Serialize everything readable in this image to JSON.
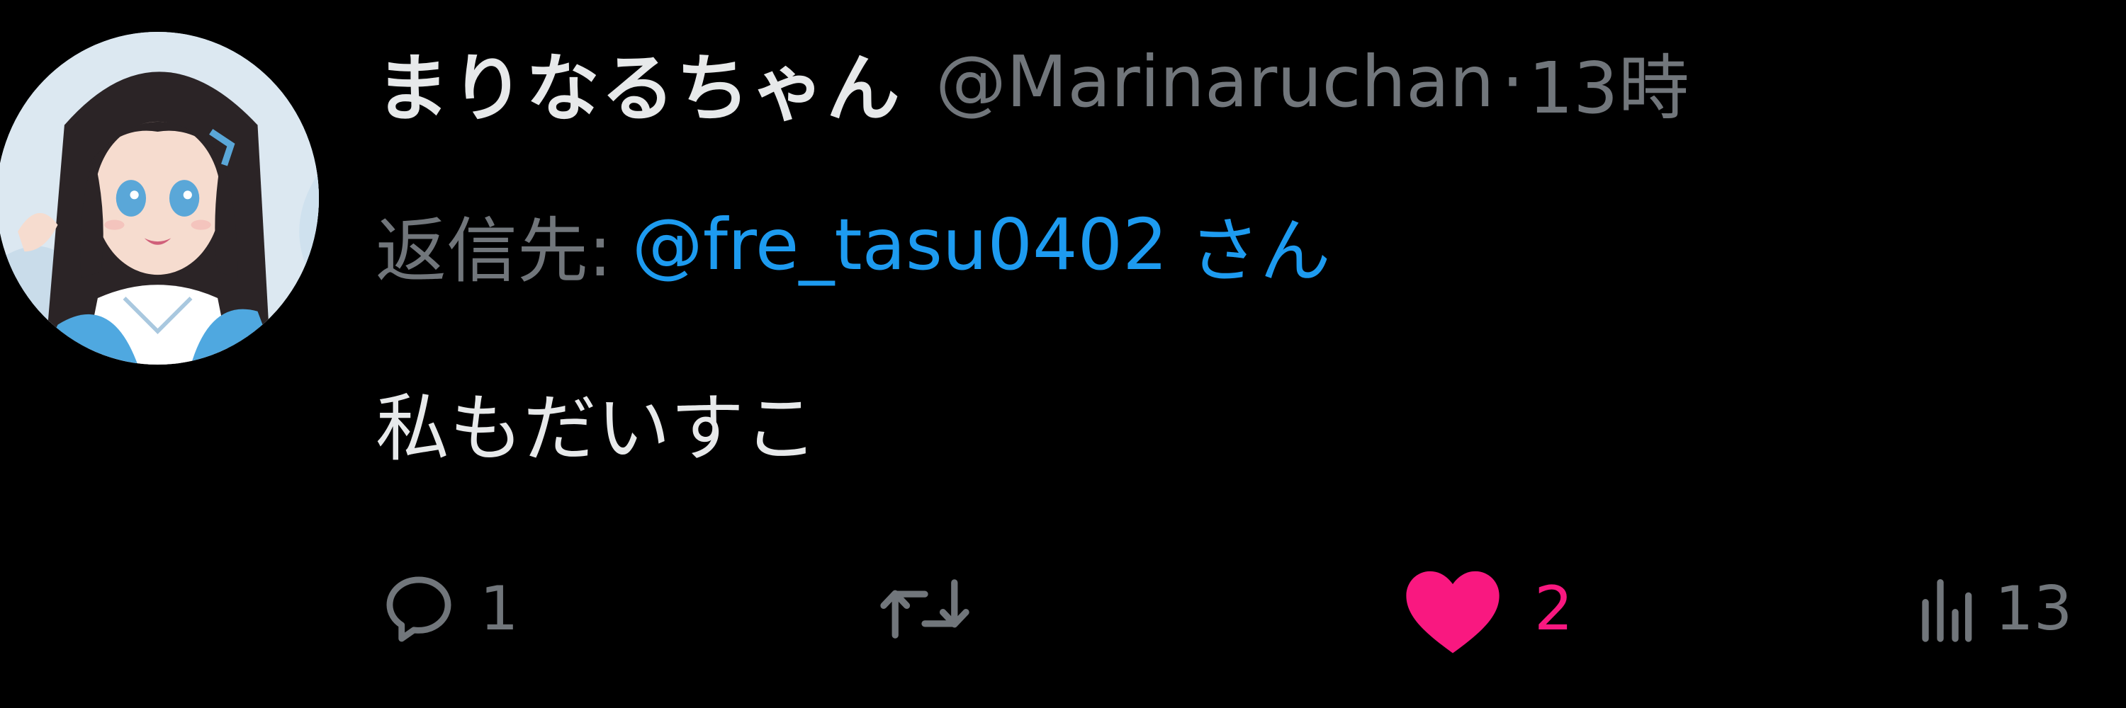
{
  "author": {
    "display_name": "まりなるちゃん",
    "handle": "@Marinaruchan",
    "separator": "·",
    "time": "13時"
  },
  "reply": {
    "prefix": "返信先:",
    "handle": "@fre_tasu0402",
    "suffix": "さん"
  },
  "tweet": {
    "text": "私もだいすこ"
  },
  "actions": {
    "reply_count": "1",
    "retweet_count": "",
    "like_count": "2",
    "view_count": "13"
  },
  "colors": {
    "background": "#000000",
    "text_primary": "#e7e9ea",
    "text_secondary": "#71767b",
    "link": "#1d9bf0",
    "like_active": "#f91880"
  },
  "icons": {
    "reply": "speech-bubble-icon",
    "retweet": "retweet-arrows-icon",
    "like": "heart-filled-icon",
    "views": "bar-chart-icon"
  }
}
